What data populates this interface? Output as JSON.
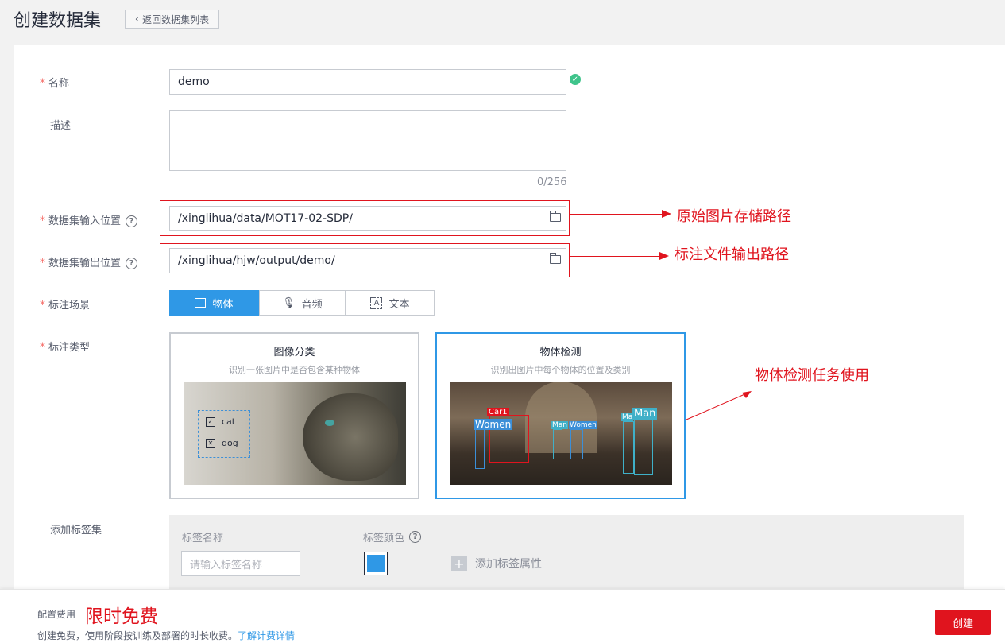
{
  "header": {
    "title": "创建数据集",
    "back_label": "返回数据集列表"
  },
  "form": {
    "name": {
      "label": "名称",
      "value": "demo"
    },
    "description": {
      "label": "描述",
      "counter": "0/256"
    },
    "input_path": {
      "label": "数据集输入位置",
      "value": "/xinglihua/data/MOT17-02-SDP/"
    },
    "output_path": {
      "label": "数据集输出位置",
      "value": "/xinglihua/hjw/output/demo/"
    },
    "scene": {
      "label": "标注场景",
      "options": [
        "物体",
        "音频",
        "文本"
      ],
      "selected": "物体"
    },
    "type": {
      "label": "标注类型",
      "cards": [
        {
          "title": "图像分类",
          "subtitle": "识别一张图片中是否包含某种物体",
          "tags": [
            "cat",
            "dog"
          ]
        },
        {
          "title": "物体检测",
          "subtitle": "识别出图片中每个物体的位置及类别",
          "boxes": [
            "Car1",
            "Women",
            "Man",
            "Women",
            "Ma",
            "Man"
          ]
        }
      ],
      "selected": "物体检测"
    },
    "tagset": {
      "label": "添加标签集",
      "name_label": "标签名称",
      "name_placeholder": "请输入标签名称",
      "color_label": "标签颜色",
      "color_value": "#2f98e6",
      "add_attr": "添加标签属性"
    }
  },
  "annotations": {
    "input": "原始图片存储路径",
    "output": "标注文件输出路径",
    "type": "物体检测任务使用"
  },
  "footer": {
    "cost_label": "配置费用",
    "cost_value": "限时免费",
    "note": "创建免费，使用阶段按训练及部署的时长收费。",
    "note_link": "了解计费详情",
    "create_label": "创建"
  }
}
